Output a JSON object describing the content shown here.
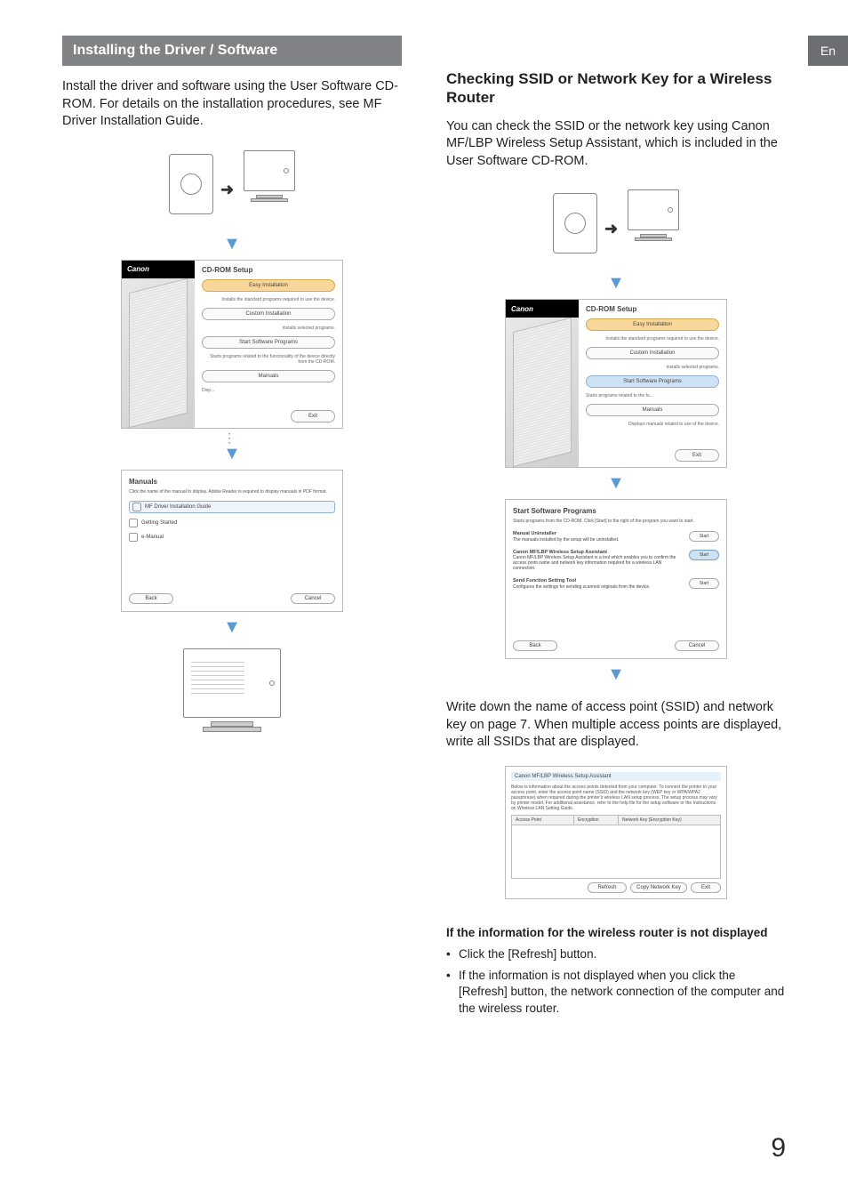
{
  "lang_tab": "En",
  "left": {
    "header": "Installing the Driver / Software",
    "intro": "Install the driver and software using the User Software CD-ROM. For details on the installation procedures, see MF Driver Installation Guide.",
    "cdrom": {
      "brand": "Canon",
      "title": "CD-ROM Setup",
      "easy": "Easy Installation",
      "easy_sub": "Installs the standard programs required to use the device.",
      "custom": "Custom Installation",
      "custom_sub": "Installs selected programs.",
      "start_sw": "Start Software Programs",
      "start_sw_sub": "Starts programs related to the functionality of the device directly from the CD-ROM.",
      "manuals": "Manuals",
      "manuals_sub": "Displays manuals related to use of the device.",
      "exit": "Exit"
    },
    "manuals_dialog": {
      "title": "Manuals",
      "sub": "Click the name of the manual to display. Adobe Reader is required to display manuals in PDF format.",
      "item_selected": "MF Driver Installation Guide",
      "item2": "Getting Started",
      "item3": "e-Manual",
      "back": "Back",
      "cancel": "Cancel"
    }
  },
  "right": {
    "subhead": "Checking SSID or Network Key for a Wireless Router",
    "intro": "You can check the SSID or the network key using Canon MF/LBP Wireless Setup Assistant, which is included in the User Software CD-ROM.",
    "cdrom": {
      "brand": "Canon",
      "title": "CD-ROM Setup",
      "easy": "Easy Installation",
      "easy_sub": "Installs the standard programs required to use the device.",
      "custom": "Custom Installation",
      "custom_sub": "Installs selected programs.",
      "start_sw": "Start Software Programs",
      "start_sw_sub": "Starts programs related to the fu...",
      "manuals": "Manuals",
      "manuals_sub": "Displays manuals related to use of the device.",
      "exit": "Exit"
    },
    "startsw": {
      "title": "Start Software Programs",
      "sub": "Starts programs from the CD-ROM. Click [Start] to the right of the program you want to start.",
      "row1_title": "Manual Uninstaller",
      "row1_body": "The manuals installed by the setup will be uninstalled.",
      "row2_title": "Canon MF/LBP Wireless Setup Assistant",
      "row2_body": "Canon MF/LBP Wireless Setup Assistant is a tool which enables you to confirm the access point name and network key information required for a wireless LAN connection.",
      "row3_title": "Send Function Setting Tool",
      "row3_body": "Configures the settings for sending scanned originals from the device.",
      "btn_start": "Start",
      "back": "Back",
      "cancel": "Cancel"
    },
    "writedown": "Write down the name of access point (SSID) and network key on page 7. When multiple access points are displayed, write all SSIDs that are displayed.",
    "assist": {
      "title": "Canon MF/LBP Wireless Setup Assistant",
      "desc": "Below is information about the access points detected from your computer. To connect the printer to your access point, enter the access point name (SSID) and the network key (WEP key or WPA/WPA2 passphrase) when required during the printer's wireless LAN setup process. The setup process may vary by printer model. For additional assistance, refer to the help file for the setup software or the Instructions on Wireless LAN Setting Guide.",
      "col1": "Access Point",
      "col2": "Encryption",
      "col3": "Network Key (Encryption Key)",
      "refresh": "Refresh",
      "copy": "Copy Network Key",
      "exit": "Exit"
    },
    "notdisp_head": "If the information for the wireless router is not displayed",
    "bullet1": "Click the [Refresh] button.",
    "bullet2": "If the information is not displayed when you click the [Refresh] button, the network connection of the computer and the wireless router."
  },
  "page_number": "9"
}
